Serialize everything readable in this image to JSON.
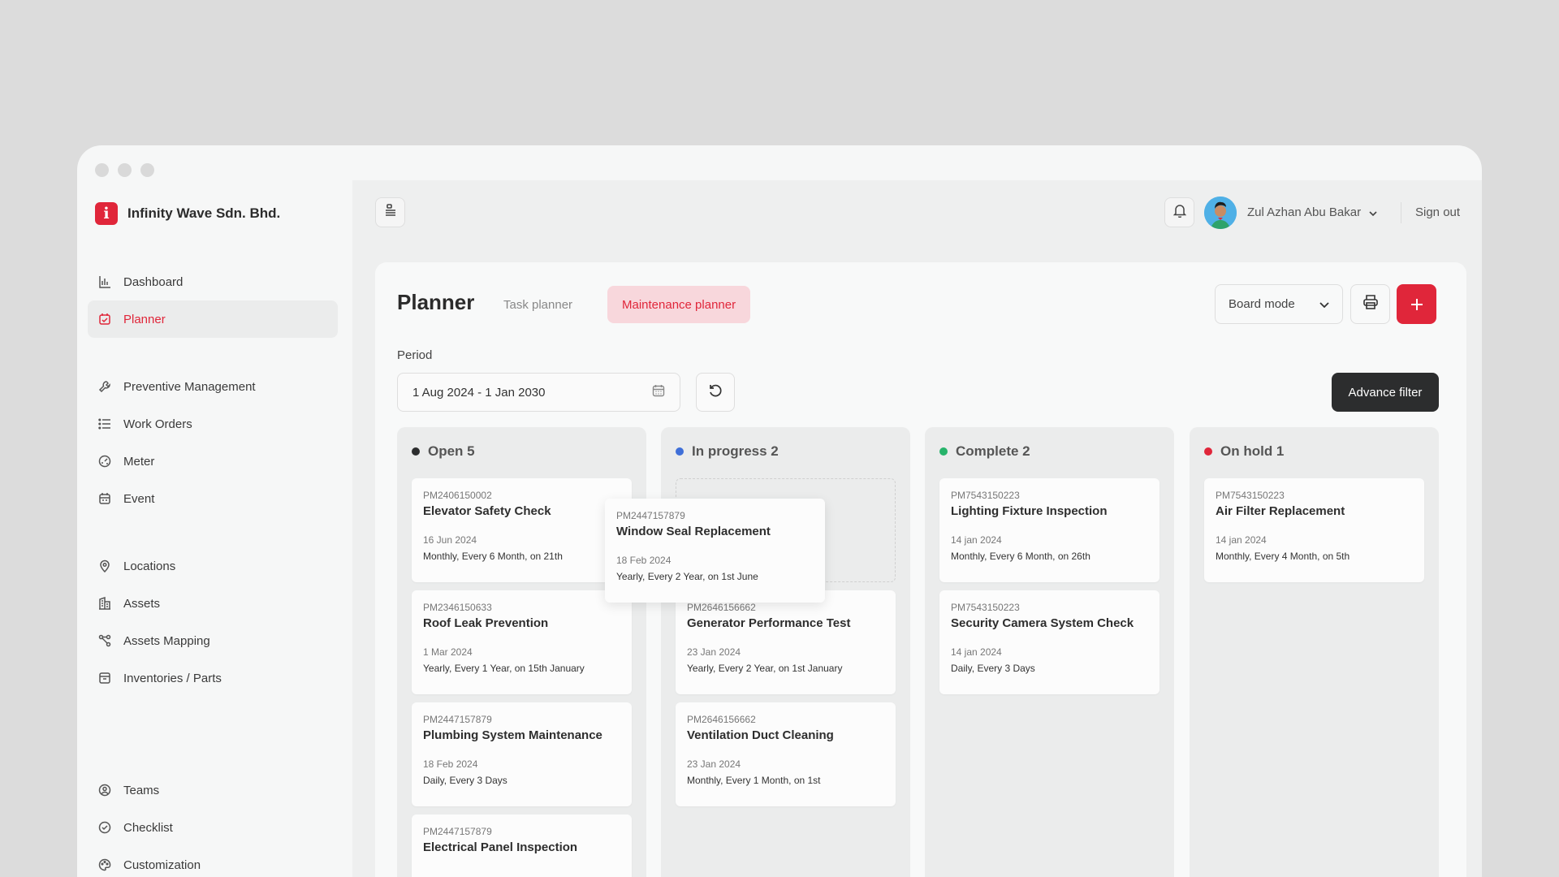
{
  "brand": {
    "logo_letter": "i",
    "name": "Infinity Wave Sdn. Bhd."
  },
  "sidebar": {
    "items": [
      {
        "label": "Dashboard",
        "icon": "bar-chart-icon"
      },
      {
        "label": "Planner",
        "icon": "calendar-icon",
        "active": true
      },
      {
        "label": "Preventive Management",
        "icon": "wrench-icon"
      },
      {
        "label": "Work Orders",
        "icon": "list-icon"
      },
      {
        "label": "Meter",
        "icon": "gauge-icon"
      },
      {
        "label": "Event",
        "icon": "event-calendar-icon"
      },
      {
        "label": "Locations",
        "icon": "pin-icon"
      },
      {
        "label": "Assets",
        "icon": "building-icon"
      },
      {
        "label": "Assets Mapping",
        "icon": "mapping-icon"
      },
      {
        "label": "Inventories / Parts",
        "icon": "box-icon"
      },
      {
        "label": "Teams",
        "icon": "team-icon"
      },
      {
        "label": "Checklist",
        "icon": "check-circle-icon"
      },
      {
        "label": "Customization",
        "icon": "palette-icon"
      }
    ]
  },
  "header": {
    "user_name": "Zul Azhan Abu Bakar",
    "sign_out": "Sign out"
  },
  "planner": {
    "title": "Planner",
    "tabs": [
      "Task planner",
      "Maintenance planner"
    ],
    "active_tab": "Maintenance planner",
    "view_mode": "Board mode",
    "period_label": "Period",
    "period_value": "1 Aug 2024 - 1 Jan 2030",
    "advance_filter": "Advance filter"
  },
  "colors": {
    "accent": "#e0263a",
    "open": "#2c2d2e",
    "in_progress": "#3f6fd8",
    "complete": "#26b36a",
    "on_hold": "#e0263a"
  },
  "columns": [
    {
      "title": "Open 5",
      "cards": [
        {
          "code": "PM2406150002",
          "name": "Elevator Safety Check",
          "date": "16 Jun 2024",
          "schedule": "Monthly,  Every 6 Month,  on 21th"
        },
        {
          "code": "PM2346150633",
          "name": "Roof Leak Prevention",
          "date": "1 Mar 2024",
          "schedule": "Yearly,  Every 1 Year, on 15th January"
        },
        {
          "code": "PM2447157879",
          "name": "Plumbing System Maintenance",
          "date": "18 Feb 2024",
          "schedule": "Daily,  Every 3 Days"
        },
        {
          "code": "PM2447157879",
          "name": "Electrical Panel Inspection",
          "date": "",
          "schedule": ""
        }
      ]
    },
    {
      "title": "In progress 2",
      "cards": [
        {
          "code": "PM2646156662",
          "name": "Generator Performance Test",
          "date": "23 Jan 2024",
          "schedule": "Yearly,  Every 2 Year,  on 1st January"
        },
        {
          "code": "PM2646156662",
          "name": "Ventilation Duct Cleaning",
          "date": "23 Jan 2024",
          "schedule": "Monthly,  Every 1 Month,  on 1st"
        }
      ]
    },
    {
      "title": "Complete 2",
      "cards": [
        {
          "code": "PM7543150223",
          "name": "Lighting Fixture Inspection",
          "date": "14 jan 2024",
          "schedule": "Monthly,  Every 6 Month,  on 26th"
        },
        {
          "code": "PM7543150223",
          "name": "Security Camera System Check",
          "date": "14 jan 2024",
          "schedule": "Daily,  Every 3 Days"
        }
      ]
    },
    {
      "title": "On hold 1",
      "cards": [
        {
          "code": "PM7543150223",
          "name": "Air Filter Replacement",
          "date": "14 jan 2024",
          "schedule": "Monthly,  Every 4 Month,  on 5th"
        }
      ]
    }
  ],
  "dragging_card": {
    "code": "PM2447157879",
    "name": "Window Seal Replacement",
    "date": "18 Feb 2024",
    "schedule": "Yearly,  Every 2 Year,  on 1st June"
  }
}
